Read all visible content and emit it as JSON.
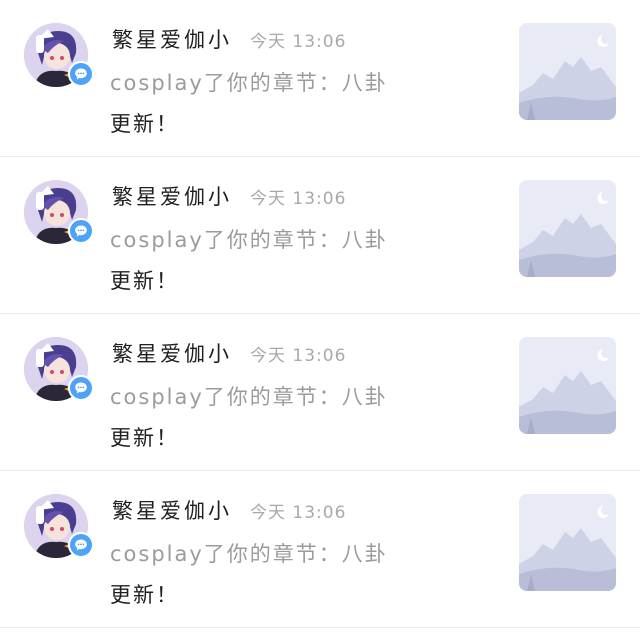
{
  "notifications": [
    {
      "user": "繁星爱伽小",
      "time": "今天 13:06",
      "message_line1": "cosplay了你的章节：八卦",
      "message_line2": "更新！"
    },
    {
      "user": "繁星爱伽小",
      "time": "今天 13:06",
      "message_line1": "cosplay了你的章节：八卦",
      "message_line2": "更新！"
    },
    {
      "user": "繁星爱伽小",
      "time": "今天 13:06",
      "message_line1": "cosplay了你的章节：八卦",
      "message_line2": "更新！"
    },
    {
      "user": "繁星爱伽小",
      "time": "今天 13:06",
      "message_line1": "cosplay了你的章节：八卦",
      "message_line2": "更新！"
    }
  ],
  "icons": {
    "badge": "chat-bubble-icon",
    "thumbnail": "image-placeholder-icon"
  },
  "colors": {
    "badge": "#4da3f7",
    "name": "#1f1f1f",
    "time": "#a9a9a9",
    "message": "#9b9b9b",
    "thumbnail_bg": "#e8ebf6"
  }
}
